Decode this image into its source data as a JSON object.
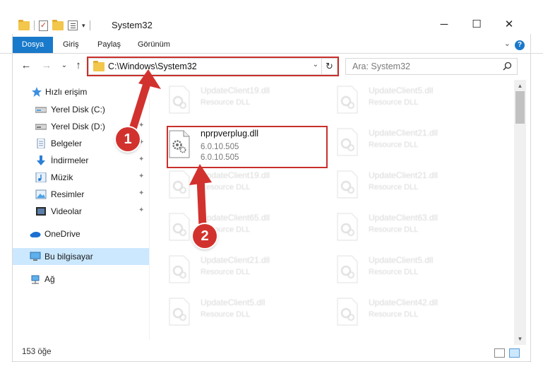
{
  "window": {
    "title": "System32",
    "minimize": "─",
    "maximize": "☐",
    "close": "✕",
    "quick_access_dropdown": "▾"
  },
  "ribbon": {
    "tabs": [
      "Dosya",
      "Giriş",
      "Paylaş",
      "Görünüm"
    ],
    "expand": "⌄",
    "help": "?"
  },
  "nav": {
    "back": "←",
    "forward": "→",
    "recent": "⌄",
    "up": "↑",
    "address": "C:\\Windows\\System32",
    "address_dropdown": "⌄",
    "refresh": "↻",
    "search_placeholder": "Ara: System32"
  },
  "sidebar": {
    "quick_access": "Hızlı erişim",
    "items": [
      {
        "label": "Yerel Disk (C:)",
        "icon": "drive-icon",
        "pinned": true
      },
      {
        "label": "Yerel Disk (D:)",
        "icon": "drive-icon",
        "pinned": true
      },
      {
        "label": "Belgeler",
        "icon": "documents-icon",
        "pinned": true
      },
      {
        "label": "İndirmeler",
        "icon": "downloads-icon",
        "pinned": true
      },
      {
        "label": "Müzik",
        "icon": "music-icon",
        "pinned": true
      },
      {
        "label": "Resimler",
        "icon": "pictures-icon",
        "pinned": true
      },
      {
        "label": "Videolar",
        "icon": "videos-icon",
        "pinned": true
      }
    ],
    "onedrive": "OneDrive",
    "this_pc": "Bu bilgisayar",
    "network": "Ağ",
    "pin_glyph": "📌"
  },
  "files": {
    "focused": {
      "name": "nprpverplug.dll",
      "file_version": "6.0.10.505",
      "product_version": "6.0.10.505"
    },
    "left_column": [
      {
        "name": "UpdateClient19.dll",
        "desc": "Resource DLL"
      },
      {
        "name": "",
        "desc": ""
      },
      {
        "name": "UpdateClient19.dll",
        "desc": "Resource DLL"
      },
      {
        "name": "UpdateClient65.dll",
        "desc": "Resource DLL"
      },
      {
        "name": "UpdateClient21.dll",
        "desc": "Resource DLL"
      },
      {
        "name": "UpdateClient5.dll",
        "desc": "Resource DLL"
      }
    ],
    "right_column": [
      {
        "name": "UpdateClient5.dll",
        "desc": "Resource DLL"
      },
      {
        "name": "UpdateClient21.dll",
        "desc": "Resource DLL"
      },
      {
        "name": "UpdateClient21.dll",
        "desc": "Resource DLL"
      },
      {
        "name": "UpdateClient63.dll",
        "desc": "Resource DLL"
      },
      {
        "name": "UpdateClient5.dll",
        "desc": "Resource DLL"
      },
      {
        "name": "UpdateClient42.dll",
        "desc": "Resource DLL"
      }
    ]
  },
  "status": {
    "count": "153 öğe"
  },
  "callouts": {
    "first": "1",
    "second": "2"
  },
  "colors": {
    "accent": "#1979ca",
    "highlight_red": "#c9302c",
    "callout_red": "#d2322e",
    "selection": "#cce8ff"
  }
}
